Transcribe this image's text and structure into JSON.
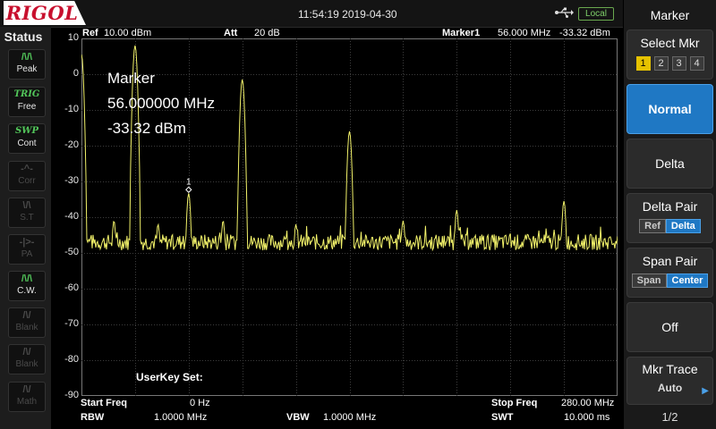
{
  "topbar": {
    "logo": "RIGOL",
    "datetime": "11:54:19 2019-04-30",
    "local_label": "Local"
  },
  "status": {
    "title": "Status",
    "buttons": [
      {
        "icon": "peak-icon",
        "glyph": "/\\/\\",
        "label": "Peak",
        "state": "on"
      },
      {
        "icon": "trig-icon",
        "glyph": "TRIG",
        "label": "Free",
        "state": "on"
      },
      {
        "icon": "swp-icon",
        "glyph": "SWP",
        "label": "Cont",
        "state": "on"
      },
      {
        "icon": "corr-icon",
        "glyph": "-^-",
        "label": "Corr",
        "state": "off"
      },
      {
        "icon": "st-icon",
        "glyph": "\\/\\",
        "label": "S.T",
        "state": "off"
      },
      {
        "icon": "pa-icon",
        "glyph": "-|>-",
        "label": "PA",
        "state": "off"
      },
      {
        "icon": "cw-icon",
        "glyph": "/\\/\\",
        "label": "C.W.",
        "state": "on"
      },
      {
        "icon": "blank-icon",
        "glyph": "/\\/",
        "label": "Blank",
        "state": "off"
      },
      {
        "icon": "blank-icon",
        "glyph": "/\\/",
        "label": "Blank",
        "state": "off"
      },
      {
        "icon": "math-icon",
        "glyph": "/\\/",
        "label": "Math",
        "state": "off"
      }
    ]
  },
  "header": {
    "ref_label": "Ref",
    "ref_value": "10.00 dBm",
    "att_label": "Att",
    "att_value": "20 dB",
    "marker_label": "Marker1",
    "marker_freq": "56.000 MHz",
    "marker_amp": "-33.32 dBm"
  },
  "marker_display": {
    "title": "Marker",
    "freq": "56.000000 MHz",
    "amp": "-33.32 dBm",
    "label": "1"
  },
  "userkey": "UserKey Set:",
  "yaxis": [
    "10",
    "0",
    "-10",
    "-20",
    "-30",
    "-40",
    "-50",
    "-60",
    "-70",
    "-80",
    "-90"
  ],
  "bottom": {
    "start_freq_label": "Start Freq",
    "start_freq_value": "0 Hz",
    "stop_freq_label": "Stop Freq",
    "stop_freq_value": "280.00 MHz",
    "rbw_label": "RBW",
    "rbw_value": "1.0000 MHz",
    "vbw_label": "VBW",
    "vbw_value": "1.0000 MHz",
    "swt_label": "SWT",
    "swt_value": "10.000 ms"
  },
  "menu": {
    "title": "Marker",
    "select_mkr": "Select Mkr",
    "markers": [
      "1",
      "2",
      "3",
      "4"
    ],
    "normal": "Normal",
    "delta": "Delta",
    "delta_pair": "Delta Pair",
    "delta_pair_ref": "Ref",
    "delta_pair_delta": "Delta",
    "span_pair": "Span Pair",
    "span_pair_span": "Span",
    "span_pair_center": "Center",
    "off": "Off",
    "mkr_trace": "Mkr Trace",
    "mkr_trace_value": "Auto",
    "page": "1/2"
  },
  "colors": {
    "trace": "#f2f26a",
    "grid": "#3c3c3c",
    "accent": "#1f78c4",
    "status_on": "#52c65a"
  },
  "chart_data": {
    "type": "line",
    "x_unit": "MHz",
    "y_unit": "dBm",
    "xlim": [
      0,
      280
    ],
    "ylim": [
      -90,
      10
    ],
    "noise_floor": -47,
    "peaks": [
      {
        "x": 0,
        "y": 5.5
      },
      {
        "x": 17,
        "y": -41
      },
      {
        "x": 28,
        "y": 8
      },
      {
        "x": 40,
        "y": -42
      },
      {
        "x": 56,
        "y": -33.32
      },
      {
        "x": 74,
        "y": -41
      },
      {
        "x": 84,
        "y": -1.5
      },
      {
        "x": 112,
        "y": -42
      },
      {
        "x": 140,
        "y": -16
      },
      {
        "x": 168,
        "y": -41
      },
      {
        "x": 196,
        "y": -38
      },
      {
        "x": 252,
        "y": -35.5
      }
    ]
  }
}
